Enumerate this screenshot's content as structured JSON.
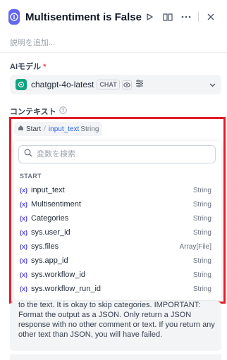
{
  "header": {
    "title": "Multisentiment is False",
    "description_placeholder": "説明を追加..."
  },
  "model": {
    "label": "AIモデル",
    "required_mark": "*",
    "name": "chatgpt-4o-latest",
    "badge": "CHAT"
  },
  "context": {
    "label": "コンテキスト",
    "chip": {
      "node": "Start",
      "variable": "input_text",
      "type": "String"
    }
  },
  "picker": {
    "search_placeholder": "変数を検索",
    "section": "START",
    "variables": [
      {
        "name": "input_text",
        "type": "String"
      },
      {
        "name": "Multisentiment",
        "type": "String"
      },
      {
        "name": "Categories",
        "type": "String"
      },
      {
        "name": "sys.user_id",
        "type": "String"
      },
      {
        "name": "sys.files",
        "type": "Array[File]"
      },
      {
        "name": "sys.app_id",
        "type": "String"
      },
      {
        "name": "sys.workflow_id",
        "type": "String"
      },
      {
        "name": "sys.workflow_run_id",
        "type": "String"
      }
    ]
  },
  "prompt": {
    "text": "to the text. It is okay to skip categories. IMPORTANT: Format the output as a JSON. Only return a JSON response with no other comment or text. If you return any other text than JSON, you will have failed."
  },
  "colors": {
    "accent": "#6366f1",
    "highlight": "#e11d2a",
    "openai": "#10a37f"
  }
}
